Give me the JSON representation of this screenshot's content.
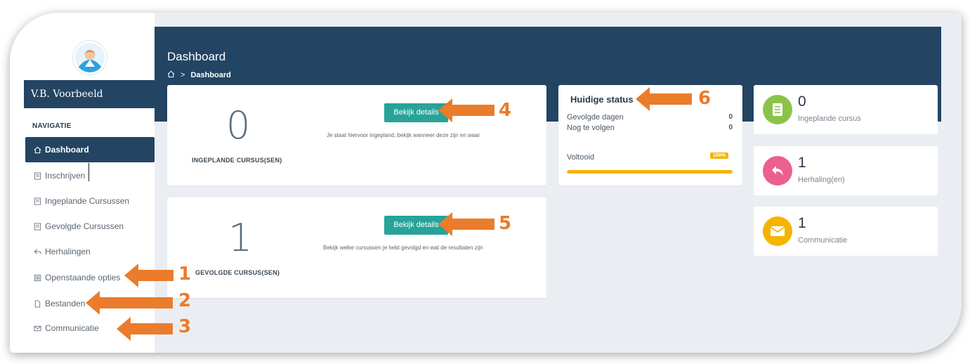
{
  "sidebar": {
    "user_name": "V.B. Voorbeeld",
    "nav_title": "NAVIGATIE",
    "items": [
      {
        "label": "Dashboard",
        "icon": "home-icon"
      },
      {
        "label": "Inschrijven",
        "icon": "book-icon"
      },
      {
        "label": "Ingeplande Cursussen",
        "icon": "book-icon"
      },
      {
        "label": "Gevolgde Cursussen",
        "icon": "book-icon"
      },
      {
        "label": "Herhalingen",
        "icon": "reply-icon"
      },
      {
        "label": "Openstaande opties",
        "icon": "list-icon"
      },
      {
        "label": "Bestanden",
        "icon": "file-icon"
      },
      {
        "label": "Communicatie",
        "icon": "mail-icon"
      }
    ]
  },
  "header": {
    "title": "Dashboard",
    "breadcrumb_home_icon": "home-icon",
    "breadcrumb_sep": ">",
    "breadcrumb_current": "Dashboard"
  },
  "planned_card": {
    "count": "0",
    "label": "INGEPLANDE CURSUS(SEN)",
    "button": "Bekijk details",
    "description": "Je staat hiervoor ingepland, bekijk wanneer deze zijn en waar"
  },
  "followed_card": {
    "count": "1",
    "label": "GEVOLGDE CURSUS(SEN)",
    "button": "Bekijk details",
    "description": "Bekijk welke cursussen je hebt gevolgd en wat de resultaten zijn"
  },
  "status": {
    "title": "Huidige status",
    "rows": [
      {
        "label": "Gevolgde dagen",
        "value": "0"
      },
      {
        "label": "Nog te volgen",
        "value": "0"
      }
    ],
    "progress_label": "Voltooid",
    "progress_badge": "100%",
    "progress_fraction": 1.0
  },
  "stats": [
    {
      "value": "0",
      "label": "Ingeplande cursus",
      "icon": "book-icon",
      "color": "#8bc34a"
    },
    {
      "value": "1",
      "label": "Herhaling(en)",
      "icon": "reply-icon",
      "color": "#ec5f8f"
    },
    {
      "value": "1",
      "label": "Communicatie",
      "icon": "mail-icon",
      "color": "#f5b400"
    }
  ],
  "annotations": {
    "labels": [
      "1",
      "2",
      "3",
      "4",
      "5",
      "6"
    ],
    "color": "#ea7c2c"
  },
  "colors": {
    "navy": "#234563",
    "teal": "#27a39a",
    "orange": "#ea7c2c"
  }
}
